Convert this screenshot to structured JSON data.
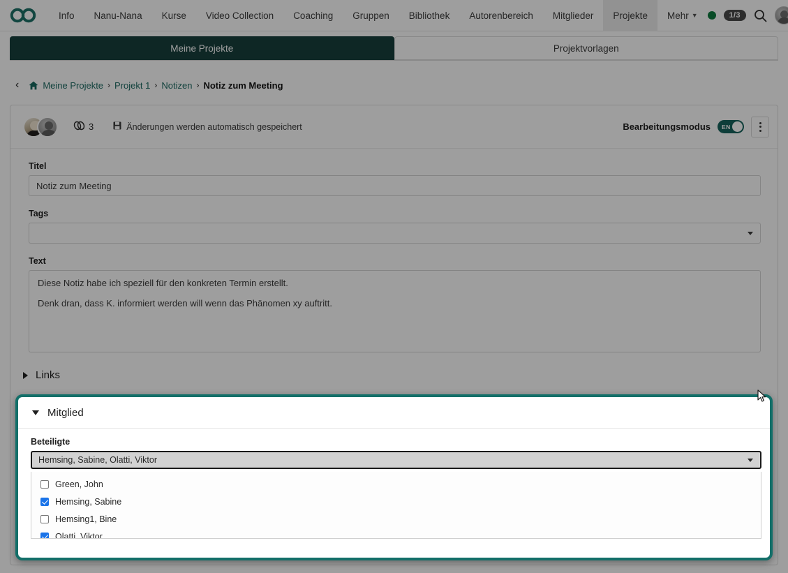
{
  "navbar": {
    "logo_icon": "infinity-logo-icon",
    "links": [
      {
        "label": "Info",
        "active": false
      },
      {
        "label": "Nanu-Nana",
        "active": false
      },
      {
        "label": "Kurse",
        "active": false
      },
      {
        "label": "Video Collection",
        "active": false
      },
      {
        "label": "Coaching",
        "active": false
      },
      {
        "label": "Gruppen",
        "active": false
      },
      {
        "label": "Bibliothek",
        "active": false
      },
      {
        "label": "Autorenbereich",
        "active": false
      },
      {
        "label": "Mitglieder",
        "active": false
      },
      {
        "label": "Projekte",
        "active": true
      }
    ],
    "more_label": "Mehr",
    "status_dot_color": "#0d7a3e",
    "count_badge": "1/3",
    "search_icon": "search-icon",
    "avatar_icon": "user-avatar-icon"
  },
  "tabs": [
    {
      "label": "Meine Projekte",
      "active": true
    },
    {
      "label": "Projektvorlagen",
      "active": false
    }
  ],
  "breadcrumb": {
    "back_icon": "chevron-left-icon",
    "home_icon": "home-icon",
    "items": [
      {
        "label": "Meine Projekte",
        "current": false
      },
      {
        "label": "Projekt 1",
        "current": false
      },
      {
        "label": "Notizen",
        "current": false
      },
      {
        "label": "Notiz zum Meeting",
        "current": true
      }
    ],
    "separator": "›"
  },
  "card_header": {
    "link_icon": "chain-link-icon",
    "link_count": "3",
    "save_icon": "floppy-disk-icon",
    "autosave_text": "Änderungen werden automatisch gespeichert",
    "edit_mode_label": "Bearbeitungsmodus",
    "toggle_text": "EN",
    "toggle_on": true,
    "menu_icon": "kebab-menu-icon"
  },
  "form": {
    "title_label": "Titel",
    "title_value": "Notiz zum Meeting",
    "tags_label": "Tags",
    "tags_value": "",
    "tags_placeholder": "",
    "text_label": "Text",
    "text_paragraphs": [
      "Diese Notiz habe ich speziell für den konkreten Termin erstellt.",
      "Denk dran, dass K. informiert werden will wenn das Phänomen xy auftritt."
    ]
  },
  "sections": {
    "links_label": "Links",
    "links_expanded": false,
    "member_label": "Mitglied",
    "member_expanded": true
  },
  "member": {
    "participants_label": "Beteiligte",
    "participants_value": "Hemsing, Sabine, Olatti, Viktor",
    "options": [
      {
        "label": "Green, John",
        "checked": false
      },
      {
        "label": "Hemsing, Sabine",
        "checked": true
      },
      {
        "label": "Hemsing1, Bine",
        "checked": false
      },
      {
        "label": "Olatti, Viktor",
        "checked": true
      }
    ]
  },
  "colors": {
    "brand_teal": "#136f69",
    "active_tab": "#173f3c",
    "link_teal": "#1d6b63",
    "checkbox_blue": "#1a73e8",
    "status_green": "#0d7a3e"
  }
}
